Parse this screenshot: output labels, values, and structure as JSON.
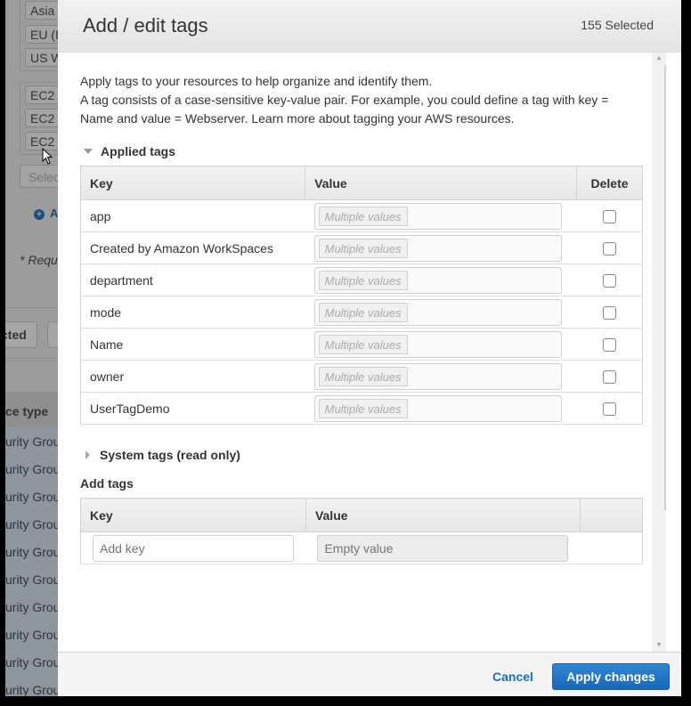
{
  "background": {
    "region_chips": [
      "Asia",
      "EU (I",
      "US W"
    ],
    "resource_chips": [
      "EC2",
      "EC2",
      "EC2"
    ],
    "select_placeholder": "Selec",
    "add_link": "A",
    "required_note": "* Requ",
    "button_partial": "cted",
    "table_header": "ce type",
    "row_values": [
      "urity Grou",
      "urity Grou",
      "urity Grou",
      "urity Grou",
      "urity Grou",
      "urity Grou",
      "urity Grou",
      "urity Grou",
      "urity Grou",
      "urity Grou"
    ]
  },
  "modal": {
    "title": "Add / edit tags",
    "selected_count": "155 Selected",
    "intro_line1": "Apply tags to your resources to help organize and identify them.",
    "intro_line2": "A tag consists of a case-sensitive key-value pair. For example, you could define a tag with key = Name and value = Webserver. Learn more about tagging your AWS resources.",
    "applied_tags": {
      "heading": "Applied tags",
      "columns": [
        "Key",
        "Value",
        "Delete"
      ],
      "rows": [
        {
          "key": "app",
          "value": "Multiple values",
          "delete": false
        },
        {
          "key": "Created by Amazon WorkSpaces",
          "value": "Multiple values",
          "delete": false
        },
        {
          "key": "department",
          "value": "Multiple values",
          "delete": false
        },
        {
          "key": "mode",
          "value": "Multiple values",
          "delete": false
        },
        {
          "key": "Name",
          "value": "Multiple values",
          "delete": false
        },
        {
          "key": "owner",
          "value": "Multiple values",
          "delete": false
        },
        {
          "key": "UserTagDemo",
          "value": "Multiple values",
          "delete": false
        }
      ]
    },
    "system_tags_heading": "System tags (read only)",
    "add_tags": {
      "heading": "Add tags",
      "columns": [
        "Key",
        "Value",
        ""
      ],
      "key_placeholder": "Add key",
      "value_placeholder": "Empty value"
    },
    "footer": {
      "cancel_label": "Cancel",
      "apply_label": "Apply changes"
    }
  },
  "colors": {
    "primary_button": "#1a66b8",
    "link": "#1a6fb8"
  }
}
